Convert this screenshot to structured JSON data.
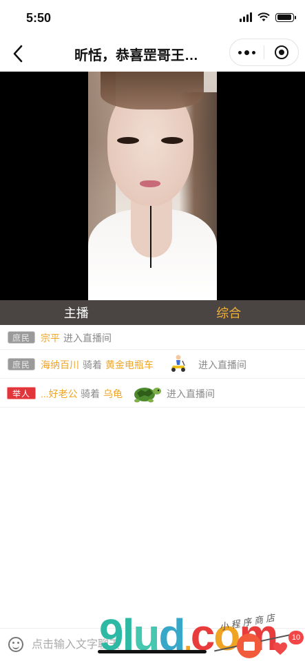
{
  "status_bar": {
    "time": "5:50",
    "battery_level": 0.95
  },
  "nav": {
    "title": "昕恬，恭喜罡哥王…",
    "back_icon": "chevron-left-icon",
    "more_icon": "more-dots-icon",
    "close_icon": "miniprogram-close-icon"
  },
  "tabs": {
    "host": "主播",
    "all": "综合"
  },
  "messages": [
    {
      "rank": "庶民",
      "user": "宗平",
      "action": "进入直播间"
    },
    {
      "rank": "庶民",
      "user": "海纳百川",
      "ride_word": "骑着",
      "vehicle": "黄金电瓶车",
      "action": "进入直播间"
    },
    {
      "rank": "举人",
      "user": "...好老公",
      "ride_word": "骑着",
      "vehicle": "乌龟",
      "action": "进入直播间"
    }
  ],
  "input": {
    "placeholder": "点击输入文字聊天"
  },
  "likes": {
    "count": "10"
  },
  "watermark": {
    "brand": "9lud.com",
    "script": "小程序商店"
  },
  "colors": {
    "accent": "#f0b23c",
    "tab_bg": "#4a4443",
    "username": "#f0a424"
  }
}
